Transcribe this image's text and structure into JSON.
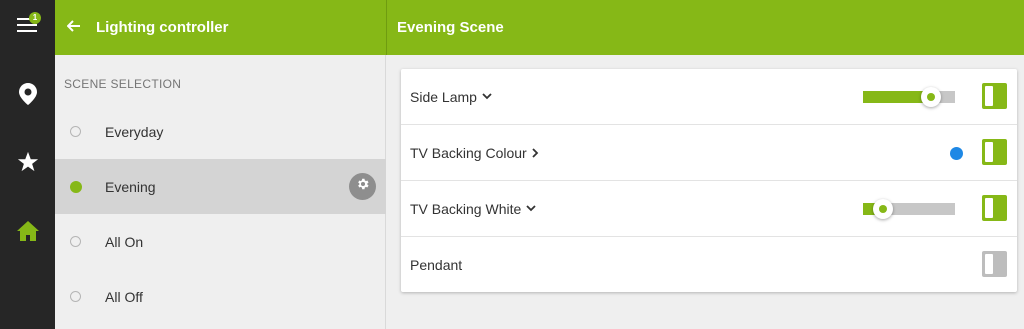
{
  "rail": {
    "items": [
      {
        "name": "menu",
        "icon": "menu-icon",
        "badge": "1"
      },
      {
        "name": "locations",
        "icon": "location-pin-icon"
      },
      {
        "name": "favourites",
        "icon": "star-icon"
      },
      {
        "name": "home",
        "icon": "home-icon",
        "active": true
      }
    ]
  },
  "header": {
    "left_title": "Lighting controller",
    "right_title": "Evening Scene"
  },
  "scenes": {
    "section_label": "SCENE SELECTION",
    "items": [
      {
        "label": "Everyday",
        "selected": false
      },
      {
        "label": "Evening",
        "selected": true
      },
      {
        "label": "All On",
        "selected": false
      },
      {
        "label": "All Off",
        "selected": false
      }
    ]
  },
  "devices": [
    {
      "name": "Side Lamp",
      "chevron": "chevron-down-icon",
      "control": "slider",
      "level": 0.74,
      "on": true
    },
    {
      "name": "TV Backing Colour",
      "chevron": "chevron-right-icon",
      "control": "colour",
      "colour": "#1e88e5",
      "on": true
    },
    {
      "name": "TV Backing White",
      "chevron": "chevron-down-icon",
      "control": "slider",
      "level": 0.22,
      "on": true
    },
    {
      "name": "Pendant",
      "control": "none",
      "on": false
    }
  ],
  "colors": {
    "accent": "#86b817",
    "rail_background": "#262626",
    "selected_row": "#d4d4d4"
  }
}
